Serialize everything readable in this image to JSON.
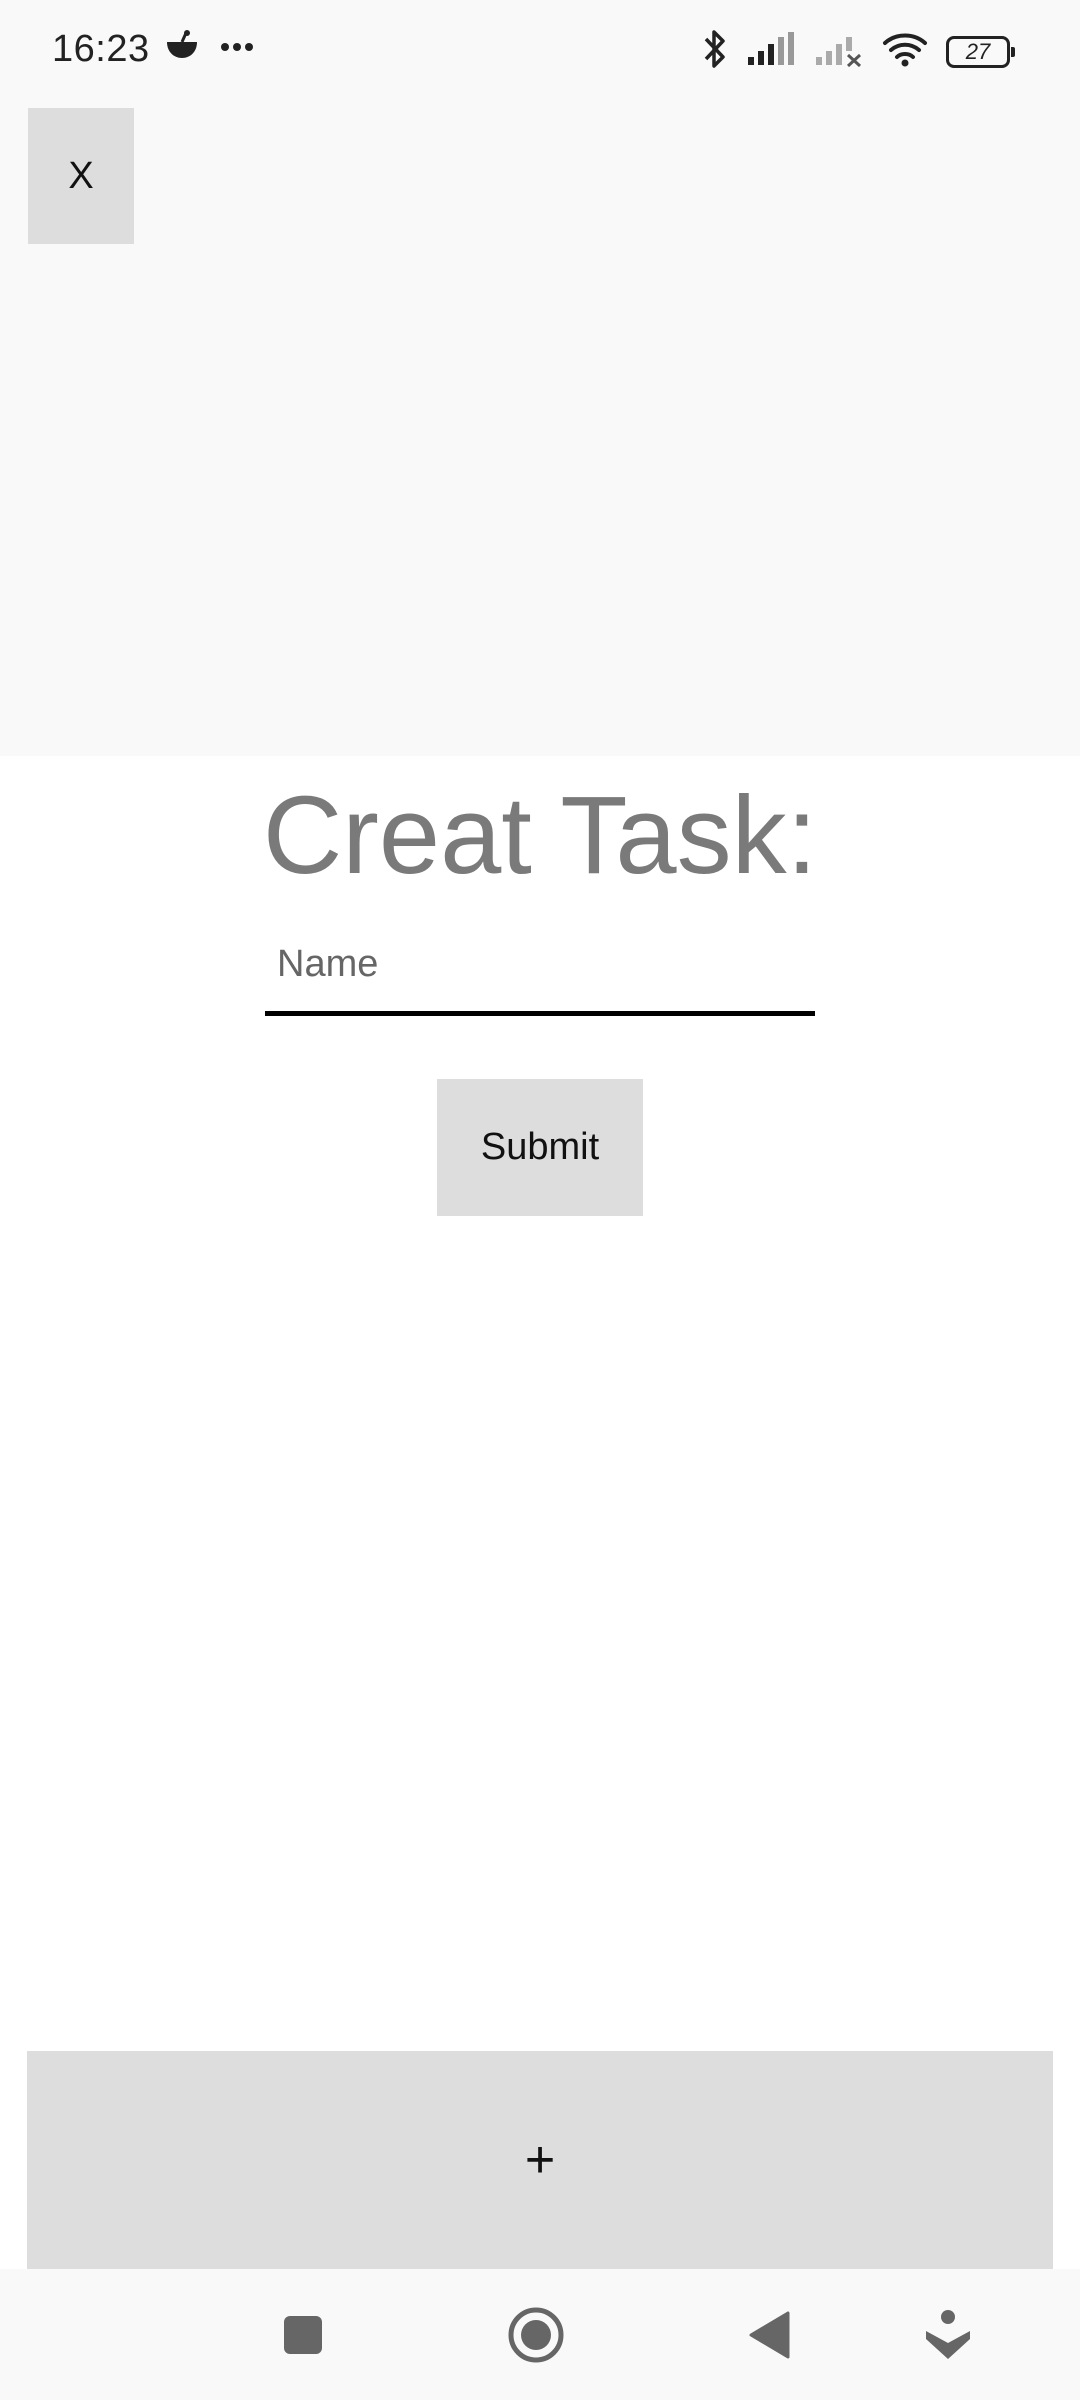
{
  "status_bar": {
    "time": "16:23",
    "battery_level": "27",
    "icons": [
      "notification-app-icon",
      "more-dots-icon",
      "bluetooth-icon",
      "signal-icon",
      "signal-no-service-icon",
      "wifi-icon",
      "battery-icon"
    ]
  },
  "header": {
    "close_label": "X"
  },
  "form": {
    "title": "Creat Task:",
    "name_placeholder": "Name",
    "name_value": "",
    "submit_label": "Submit"
  },
  "footer": {
    "add_label": "+"
  },
  "nav_bar": {
    "items": [
      "recents-square-icon",
      "home-circle-icon",
      "back-triangle-icon",
      "assistant-icon"
    ]
  },
  "colors": {
    "button_bg": "#dddddd",
    "top_area_bg": "#f9f9f9",
    "title_color": "#7a7a7a",
    "underline": "#000000"
  }
}
